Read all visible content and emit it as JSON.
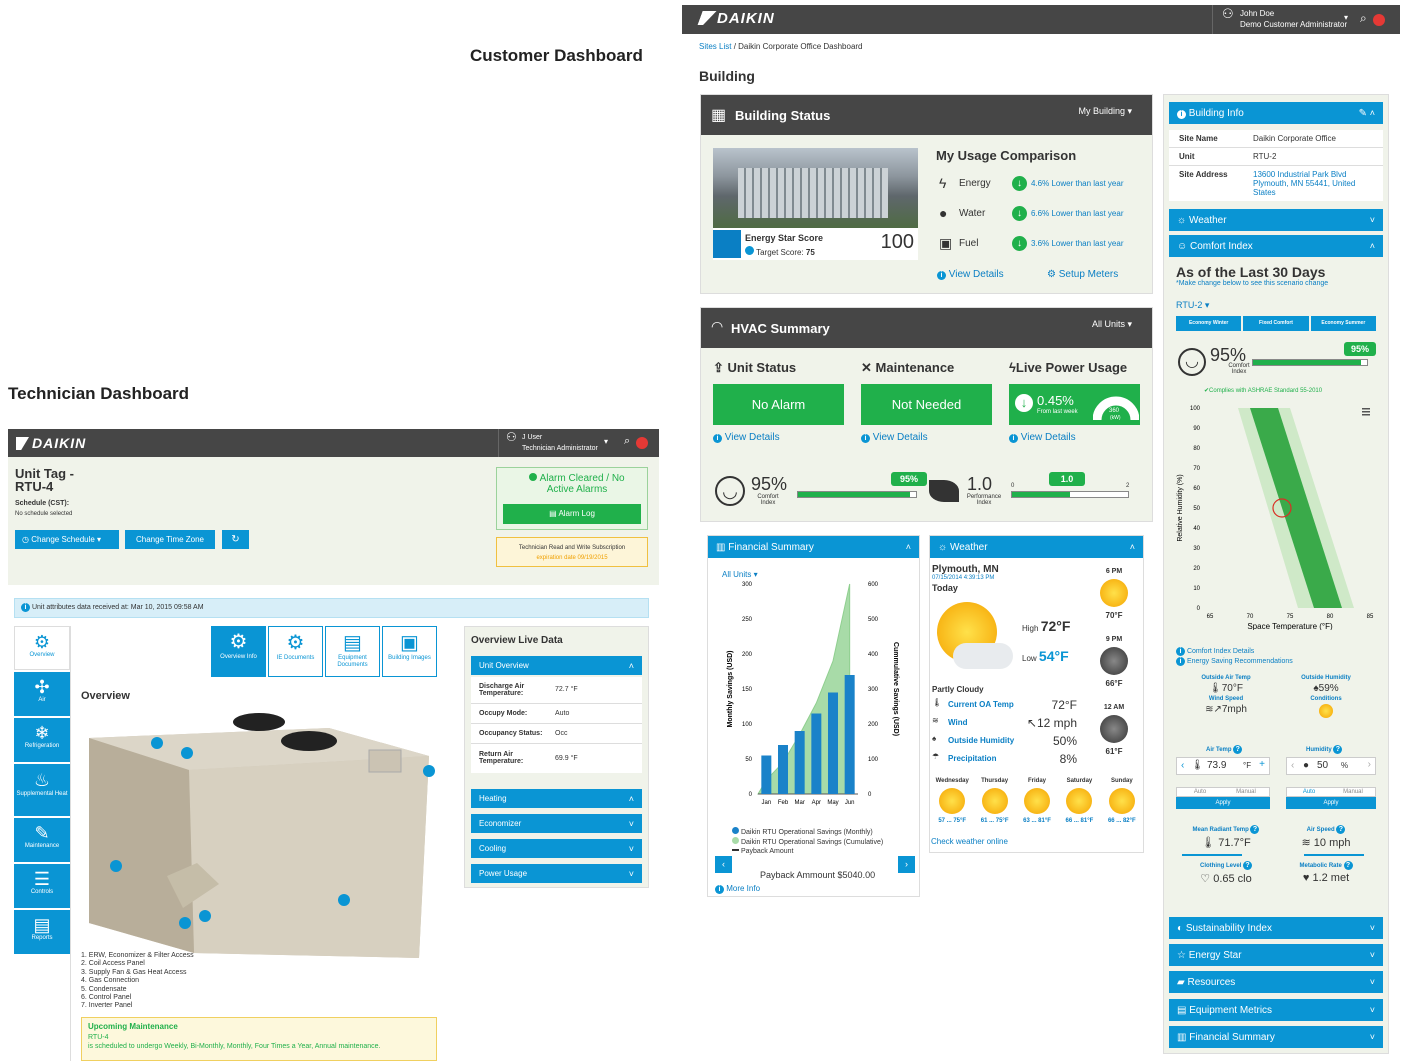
{
  "labels": {
    "customer": "Customer Dashboard",
    "technician": "Technician Dashboard"
  },
  "cust": {
    "logo": "DAIKIN",
    "user": {
      "name": "John Doe",
      "role": "Demo Customer Administrator"
    },
    "breadcrumb": {
      "link": "Sites List",
      "rest": "/ Daikin Corporate Office Dashboard"
    },
    "page_title": "Building",
    "building_status": {
      "title": "Building Status",
      "menu": "My Building ▾",
      "energy_star_label": "Energy Star Score",
      "target": "Target Score:",
      "target_value": "75",
      "score": "100",
      "usage_title": "My Usage Comparison",
      "usage": [
        {
          "name": "Energy",
          "value": "4.6% Lower than last year"
        },
        {
          "name": "Water",
          "value": "6.6% Lower than last year"
        },
        {
          "name": "Fuel",
          "value": "3.6% Lower than last year"
        }
      ],
      "view_details": "View Details",
      "setup_meters": "Setup Meters"
    },
    "hvac": {
      "title": "HVAC Summary",
      "menu": "All Units ▾",
      "unit_status": {
        "title": "Unit Status",
        "value": "No Alarm"
      },
      "maintenance": {
        "title": "Maintenance",
        "value": "Not Needed"
      },
      "live_power": {
        "title": "Live Power Usage",
        "value": "0.45%",
        "sub": "From last week",
        "gauge": "360",
        "gauge_unit": "(kW)"
      },
      "view_details": "View Details",
      "comfort": {
        "value": "95%",
        "label": "Comfort Index",
        "badge": "95%",
        "level": 0.95
      },
      "performance": {
        "value": "1.0",
        "label": "Performance Index",
        "badge": "1.0",
        "min": "0",
        "max": "2",
        "level": 0.5
      }
    },
    "financial": {
      "title": "Financial Summary",
      "menu": "All Units ▾",
      "more": "More Info",
      "payback": "Payback Ammount $5040.00",
      "legend": [
        "Daikin RTU Operational Savings (Monthly)",
        "Daikin RTU Operational Savings (Cumulative)",
        "Payback Amount"
      ]
    },
    "weather": {
      "title": "Weather",
      "location": "Plymouth, MN",
      "datetime": "07/15/2014 4:39:13 PM",
      "today": "Today",
      "high_label": "High",
      "high": "72°F",
      "low_label": "Low",
      "low": "54°F",
      "condition": "Partly Cloudy",
      "rows": [
        {
          "label": "Current OA Temp",
          "value": "72°F"
        },
        {
          "label": "Wind",
          "value": "↖12 mph"
        },
        {
          "label": "Outside Humidity",
          "value": "50%"
        },
        {
          "label": "Precipitation",
          "value": "8%"
        }
      ],
      "hourly": [
        {
          "t": "6 PM",
          "v": "70°F"
        },
        {
          "t": "9 PM",
          "v": "66°F"
        },
        {
          "t": "12 AM",
          "v": "61°F"
        }
      ],
      "days": [
        {
          "d": "Wednesday",
          "r": "57 ... 75°F"
        },
        {
          "d": "Thursday",
          "r": "61 ... 75°F"
        },
        {
          "d": "Friday",
          "r": "63 ... 81°F"
        },
        {
          "d": "Saturday",
          "r": "66 ... 81°F"
        },
        {
          "d": "Sunday",
          "r": "66 ... 82°F"
        }
      ],
      "check": "Check weather online"
    },
    "side": {
      "building_info": "Building Info",
      "info": [
        {
          "k": "Site Name",
          "v": "Daikin Corporate Office"
        },
        {
          "k": "Unit",
          "v": "RTU-2"
        },
        {
          "k": "Site Address",
          "v": "13600 Industrial Park Blvd Plymouth, MN 55441, United States"
        }
      ],
      "weather": "Weather",
      "comfort_index": "Comfort Index",
      "last30": "As of the Last 30 Days",
      "note": "*Make change below to see this scenario change",
      "unit": "RTU-2 ▾",
      "tabs": [
        "Economy Winter",
        "Fixed Comfort",
        "Economy Summer"
      ],
      "comfort_value": "95%",
      "comfort_label": "Comfort Index",
      "badge": "95%",
      "ashrae": "✔Complies with ASHRAE Standard 55-2010",
      "ylabel": "Relative Humidity (%)",
      "xlabel": "Space Temperature (°F)",
      "links": [
        "Comfort Index Details",
        "Energy Saving Recommendations"
      ],
      "outside": [
        {
          "k": "Outside Air Temp",
          "v": "70°F"
        },
        {
          "k": "Outside Humidity",
          "v": "59%"
        },
        {
          "k": "Wind Speed",
          "v": "↗7mph"
        },
        {
          "k": "Conditions",
          "v": ""
        }
      ],
      "air_temp": {
        "label": "Air Temp",
        "value": "73.9",
        "unit": "°F"
      },
      "humidity": {
        "label": "Humidity",
        "value": "50",
        "unit": "%"
      },
      "auto": "Auto",
      "manual": "Manual",
      "apply": "Apply",
      "metrics": [
        {
          "k": "Mean Radiant Temp",
          "v": "71.7°F"
        },
        {
          "k": "Air Speed",
          "v": "10 mph"
        },
        {
          "k": "Clothing Level",
          "v": "0.65 clo"
        },
        {
          "k": "Metabolic Rate",
          "v": "1.2 met"
        }
      ],
      "sections": [
        "Sustainability Index",
        "Energy Star",
        "Resources",
        "Equipment Metrics",
        "Financial Summary"
      ]
    }
  },
  "tech": {
    "logo": "DAIKIN",
    "user": {
      "name": "J User",
      "role": "Technician Administrator"
    },
    "unit_tag": "Unit Tag - RTU-4",
    "schedule": "Schedule (CST):",
    "schedule_value": "No schedule selected",
    "buttons": [
      "Change Schedule ▾",
      "Change Time Zone"
    ],
    "alarm": "Alarm Cleared / No Active Alarms",
    "alarm_log": "Alarm Log",
    "subscription": "Technician Read and Write Subscription",
    "expiration": "expiration date 09/19/2015",
    "info_bar": "Unit attributes data received at: Mar 10, 2015 09:58 AM",
    "nav": [
      "Overview",
      "Air",
      "Refrigeration",
      "Supplemental Heat",
      "Maintenance",
      "Controls",
      "Reports"
    ],
    "tabs": [
      "Overview Info",
      "IE Documents",
      "Equipment Documents",
      "Building Images"
    ],
    "overview": "Overview",
    "parts": [
      "1. ERW, Economizer & Filter Access",
      "2. Coil Access Panel",
      "3. Supply Fan & Gas Heat Access",
      "4. Gas Connection",
      "5. Condensate",
      "6. Control Panel",
      "7. Inverter Panel"
    ],
    "upcoming_title": "Upcoming Maintenance",
    "upcoming_unit": "RTU-4",
    "upcoming_text": "is scheduled to undergo Weekly, Bi-Monthly, Monthly, Four Times a Year, Annual maintenance.",
    "live_title": "Overview Live Data",
    "unit_overview": "Unit Overview",
    "live": [
      {
        "k": "Discharge Air Temperature:",
        "v": "72.7 °F"
      },
      {
        "k": "Occupy Mode:",
        "v": "Auto"
      },
      {
        "k": "Occupancy Status:",
        "v": "Occ"
      },
      {
        "k": "Return Air Temperature:",
        "v": "69.9 °F"
      }
    ],
    "sections": [
      "Heating",
      "Economizer",
      "Cooling",
      "Power Usage"
    ]
  },
  "chart_data": {
    "type": "bar",
    "title": "Financial Summary",
    "categories": [
      "Jan",
      "Feb",
      "Mar",
      "Apr",
      "May",
      "Jun"
    ],
    "ylabel": "Monthly Savings (USD)",
    "y2label": "Cummulative Savings (USD)",
    "ylim": [
      0,
      300
    ],
    "y2lim": [
      0,
      600
    ],
    "y_ticks": [
      0,
      50,
      100,
      150,
      200,
      250,
      300
    ],
    "y2_ticks": [
      0,
      100,
      200,
      300,
      400,
      500,
      600
    ],
    "series": [
      {
        "name": "Daikin RTU Operational Savings (Monthly)",
        "type": "bar",
        "values": [
          55,
          70,
          90,
          115,
          145,
          170
        ]
      },
      {
        "name": "Daikin RTU Operational Savings (Cumulative)",
        "type": "area",
        "values": [
          40,
          90,
          170,
          260,
          380,
          600
        ]
      }
    ],
    "colors": {
      "bar": "#1a82c9",
      "area": "#a8dba8"
    }
  }
}
